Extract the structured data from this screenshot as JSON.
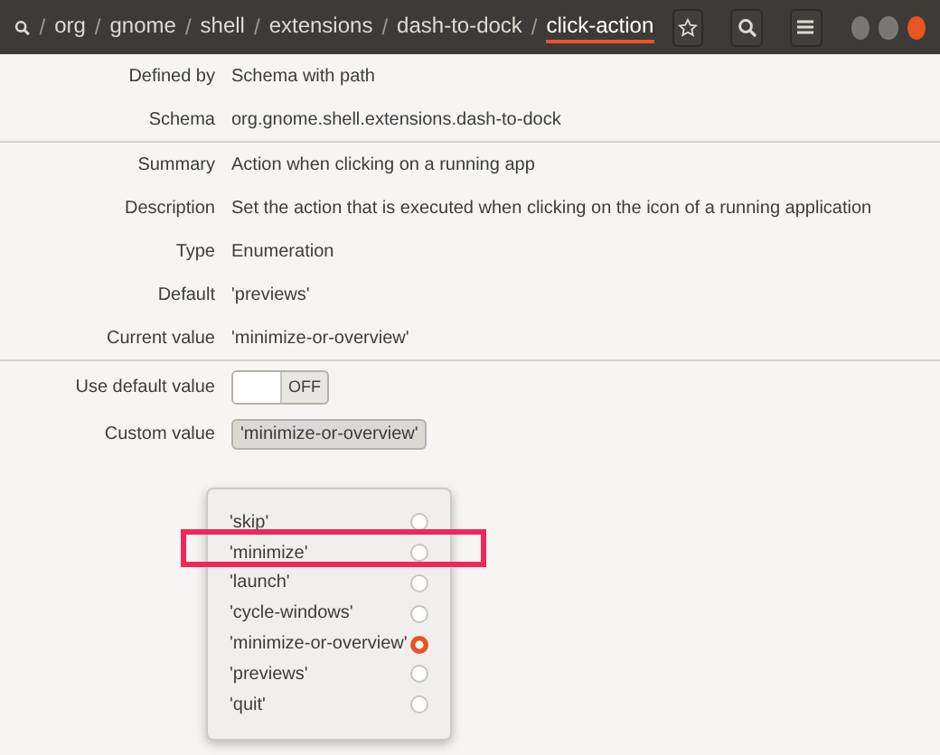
{
  "header": {
    "path": [
      {
        "label": "org",
        "current": false
      },
      {
        "label": "gnome",
        "current": false
      },
      {
        "label": "shell",
        "current": false
      },
      {
        "label": "extensions",
        "current": false
      },
      {
        "label": "dash-to-dock",
        "current": false
      },
      {
        "label": "click-action",
        "current": true
      }
    ],
    "separator": "/"
  },
  "sections": [
    {
      "rows": [
        {
          "label": "Defined by",
          "value": "Schema with path"
        },
        {
          "label": "Schema",
          "value": "org.gnome.shell.extensions.dash-to-dock"
        }
      ]
    },
    {
      "rows": [
        {
          "label": "Summary",
          "value": "Action when clicking on a running app"
        },
        {
          "label": "Description",
          "value": "Set the action that is executed when clicking on the icon of a running application"
        },
        {
          "label": "Type",
          "value": "Enumeration"
        },
        {
          "label": "Default",
          "value": "'previews'"
        },
        {
          "label": "Current value",
          "value": "'minimize-or-overview'"
        }
      ]
    }
  ],
  "use_default": {
    "label": "Use default value",
    "on": false,
    "state_text": "OFF"
  },
  "custom": {
    "label": "Custom value",
    "value": "'minimize-or-overview'"
  },
  "options": [
    {
      "label": "'skip'",
      "selected": false,
      "highlighted": false
    },
    {
      "label": "'minimize'",
      "selected": false,
      "highlighted": true
    },
    {
      "label": "'launch'",
      "selected": false,
      "highlighted": false
    },
    {
      "label": "'cycle-windows'",
      "selected": false,
      "highlighted": false
    },
    {
      "label": "'minimize-or-overview'",
      "selected": true,
      "highlighted": false
    },
    {
      "label": "'previews'",
      "selected": false,
      "highlighted": false
    },
    {
      "label": "'quit'",
      "selected": false,
      "highlighted": false
    }
  ]
}
